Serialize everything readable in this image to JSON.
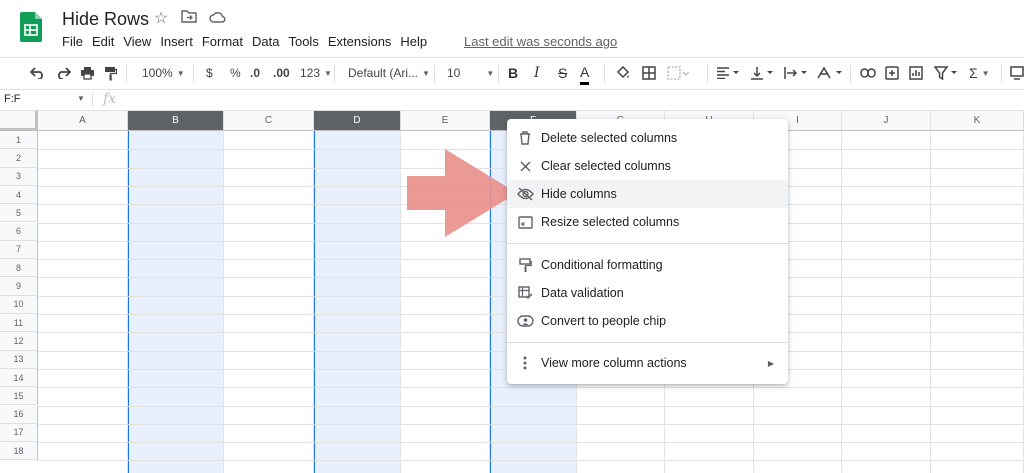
{
  "app": {
    "doc_title": "Hide Rows",
    "menu": [
      "File",
      "Edit",
      "View",
      "Insert",
      "Format",
      "Data",
      "Tools",
      "Extensions",
      "Help"
    ],
    "last_edit": "Last edit was seconds ago",
    "brand_color": "#0f9d58"
  },
  "toolbar": {
    "zoom": "100%",
    "currency": "$",
    "percent": "%",
    "dec_decrease": ".0",
    "dec_increase": ".00",
    "more_formats": "123",
    "font": "Default (Ari...",
    "font_size": "10",
    "bold": "B",
    "italic": "I",
    "strike": "S",
    "text_color": "A",
    "functions": "Σ"
  },
  "formula_bar": {
    "name_box": "F:F",
    "fx": "fx"
  },
  "grid": {
    "columns": [
      "A",
      "B",
      "C",
      "D",
      "E",
      "F",
      "G",
      "H",
      "I",
      "J",
      "K"
    ],
    "selected_columns": [
      "B",
      "D",
      "F"
    ],
    "rows": [
      "1",
      "2",
      "3",
      "4",
      "5",
      "6",
      "7",
      "8",
      "9",
      "10",
      "11",
      "12",
      "13",
      "14",
      "15",
      "16",
      "17",
      "18"
    ],
    "selection_color": "#e8f0fe",
    "selection_border": "#1a73e8"
  },
  "context_menu": {
    "items": [
      {
        "label": "Delete selected columns",
        "icon": "trash-icon"
      },
      {
        "label": "Clear selected columns",
        "icon": "close-icon"
      },
      {
        "label": "Hide columns",
        "icon": "eye-off-icon"
      },
      {
        "label": "Resize selected columns",
        "icon": "resize-icon"
      },
      {
        "label": "Conditional formatting",
        "icon": "paint-roller-icon"
      },
      {
        "label": "Data validation",
        "icon": "data-validation-icon"
      },
      {
        "label": "Convert to people chip",
        "icon": "people-chip-icon"
      },
      {
        "label": "View more column actions",
        "icon": "more-vert-icon"
      }
    ],
    "highlighted": "Hide columns"
  },
  "annotation": {
    "arrow_color": "#e8908c"
  }
}
